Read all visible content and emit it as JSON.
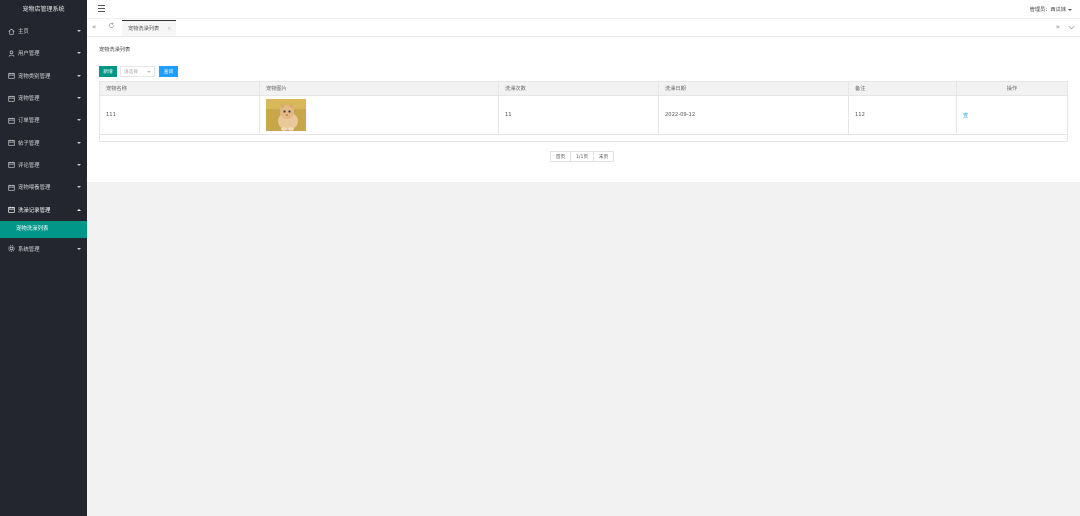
{
  "app": {
    "title": "宠物店管理系统"
  },
  "sidebar": {
    "items": [
      {
        "label": "主页",
        "icon": "home-icon"
      },
      {
        "label": "用户管理",
        "icon": "user-icon"
      },
      {
        "label": "宠物类别管理",
        "icon": "calendar-icon"
      },
      {
        "label": "宠物管理",
        "icon": "calendar-icon"
      },
      {
        "label": "订单管理",
        "icon": "calendar-icon"
      },
      {
        "label": "帖子管理",
        "icon": "calendar-icon"
      },
      {
        "label": "评论管理",
        "icon": "calendar-icon"
      },
      {
        "label": "宠物喂養管理",
        "icon": "calendar-icon"
      },
      {
        "label": "洗澡记录管理",
        "icon": "calendar-icon"
      },
      {
        "label": "系统管理",
        "icon": "gear-icon"
      }
    ],
    "active_sub": "宠物洗澡列表"
  },
  "header": {
    "admin_label": "管理员：西瓜妹"
  },
  "tabs": [
    {
      "label": "宠物洗澡列表",
      "close": "×"
    }
  ],
  "main": {
    "breadcrumb": "宠物洗澡列表",
    "add_label": "新增",
    "select_placeholder": "请选择",
    "search_label": "查询",
    "columns": [
      "宠物名称",
      "宠物图片",
      "洗澡次数",
      "洗澡日期",
      "备注",
      "操作"
    ],
    "rows": [
      {
        "name": "111",
        "image": "kitten",
        "count": "11",
        "date": "2022-09-12",
        "note": "112",
        "action": "查"
      }
    ],
    "pager": {
      "first": "首页",
      "page": "1/1页",
      "last": "末页"
    }
  },
  "colors": {
    "sidebar": "#23262e",
    "accent": "#009688",
    "blue": "#1e9fff"
  }
}
